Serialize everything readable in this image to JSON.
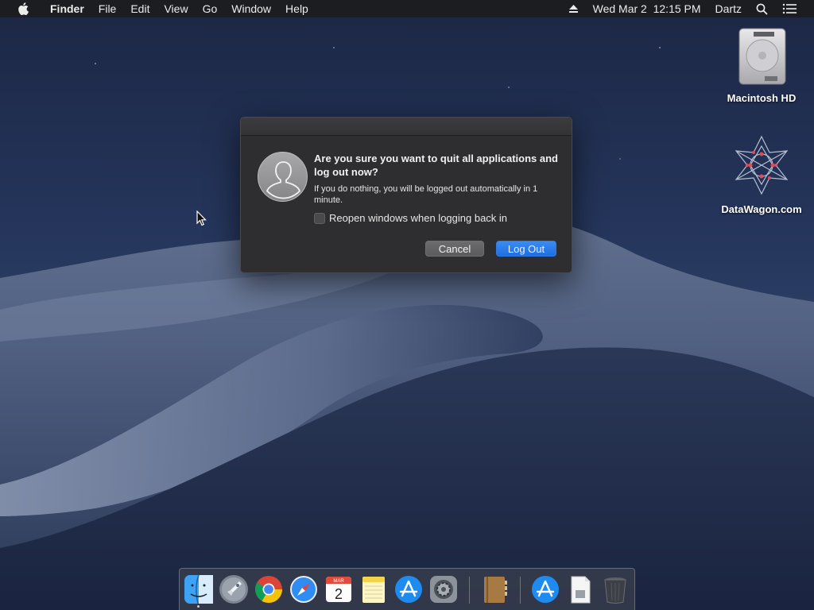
{
  "menubar": {
    "app_name": "Finder",
    "items": [
      "File",
      "Edit",
      "View",
      "Go",
      "Window",
      "Help"
    ],
    "datetime": "Wed Mar 2  12:15 PM",
    "user": "Dartz"
  },
  "desktop": {
    "icons": [
      {
        "label": "Macintosh HD",
        "icon": "hard-drive-icon"
      },
      {
        "label": "DataWagon.com",
        "icon": "datawagon-logo-icon"
      }
    ]
  },
  "dialog": {
    "heading": "Are you sure you want to quit all applications and log out now?",
    "message": "If you do nothing, you will be logged out automatically in 1 minute.",
    "checkbox_label": "Reopen windows when logging back in",
    "checkbox_checked": false,
    "cancel_label": "Cancel",
    "logout_label": "Log Out",
    "accent_color": "#2a7cf0"
  },
  "dock": {
    "apps": [
      {
        "name": "Finder",
        "icon": "finder-icon",
        "running": true
      },
      {
        "name": "Launchpad",
        "icon": "launchpad-icon"
      },
      {
        "name": "Chrome",
        "icon": "chrome-icon"
      },
      {
        "name": "Safari",
        "icon": "safari-icon"
      },
      {
        "name": "Calendar",
        "icon": "calendar-icon",
        "month": "MAR",
        "day": "2"
      },
      {
        "name": "Notes",
        "icon": "notes-icon"
      },
      {
        "name": "App Store",
        "icon": "app-store-icon"
      },
      {
        "name": "System Preferences",
        "icon": "system-preferences-icon"
      },
      {
        "name": "Contacts",
        "icon": "contacts-book-icon"
      },
      {
        "name": "App Store",
        "icon": "app-store-icon"
      },
      {
        "name": "Document",
        "icon": "document-icon"
      },
      {
        "name": "Trash",
        "icon": "trash-icon"
      }
    ]
  }
}
